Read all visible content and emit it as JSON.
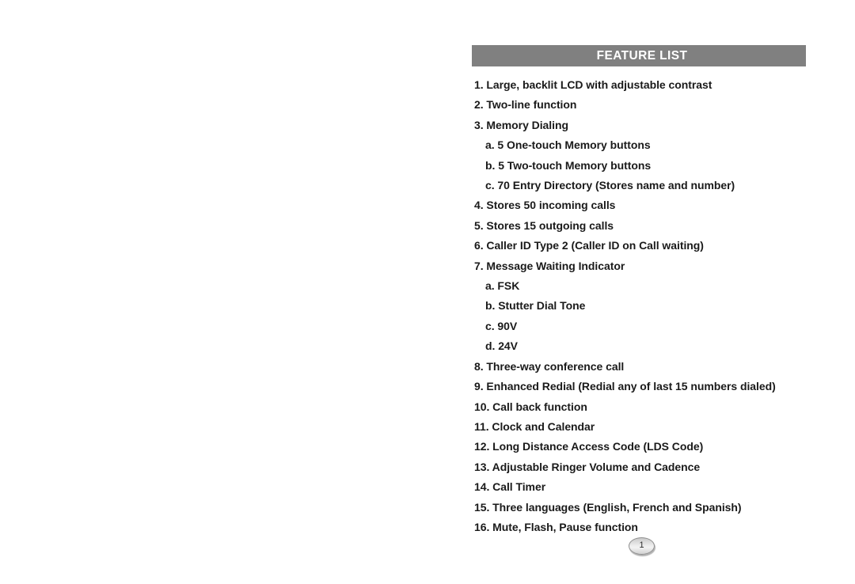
{
  "page": {
    "background_color": "#ffffff",
    "number_label": "1"
  },
  "header": {
    "title": "FEATURE LIST",
    "background_color": "#808080",
    "text_color": "#ffffff"
  },
  "feature_list": {
    "items": [
      {
        "level": 1,
        "marker": "1.",
        "text": "Large, backlit LCD with adjustable contrast"
      },
      {
        "level": 1,
        "marker": "2.",
        "text": "Two-line function"
      },
      {
        "level": 1,
        "marker": "3.",
        "text": "Memory Dialing"
      },
      {
        "level": 2,
        "marker": "a.",
        "text": "5 One-touch Memory buttons"
      },
      {
        "level": 2,
        "marker": "b.",
        "text": "5 Two-touch Memory buttons"
      },
      {
        "level": 2,
        "marker": "c.",
        "text": "70 Entry Directory (Stores name and number)"
      },
      {
        "level": 1,
        "marker": "4.",
        "text": "Stores 50 incoming calls"
      },
      {
        "level": 1,
        "marker": "5.",
        "text": "Stores 15 outgoing calls"
      },
      {
        "level": 1,
        "marker": "6.",
        "text": "Caller ID Type 2 (Caller ID on Call waiting)"
      },
      {
        "level": 1,
        "marker": "7.",
        "text": "Message Waiting Indicator"
      },
      {
        "level": 2,
        "marker": "a.",
        "text": "FSK"
      },
      {
        "level": 2,
        "marker": "b.",
        "text": "Stutter Dial Tone"
      },
      {
        "level": 2,
        "marker": "c.",
        "text": "90V"
      },
      {
        "level": 2,
        "marker": "d.",
        "text": "24V"
      },
      {
        "level": 1,
        "marker": "8.",
        "text": "Three-way conference call"
      },
      {
        "level": 1,
        "marker": "9.",
        "text": "Enhanced Redial (Redial any of last 15 numbers dialed)"
      },
      {
        "level": 1,
        "marker": "10.",
        "text": "Call back function"
      },
      {
        "level": 1,
        "marker": "11.",
        "text": "Clock and Calendar"
      },
      {
        "level": 1,
        "marker": "12.",
        "text": "Long Distance Access Code (LDS Code)"
      },
      {
        "level": 1,
        "marker": "13.",
        "text": "Adjustable Ringer Volume and Cadence"
      },
      {
        "level": 1,
        "marker": "14.",
        "text": "Call Timer"
      },
      {
        "level": 1,
        "marker": "15.",
        "text": "Three languages (English, French and Spanish)"
      },
      {
        "level": 1,
        "marker": "16.",
        "text": "Mute, Flash, Pause function"
      }
    ]
  }
}
